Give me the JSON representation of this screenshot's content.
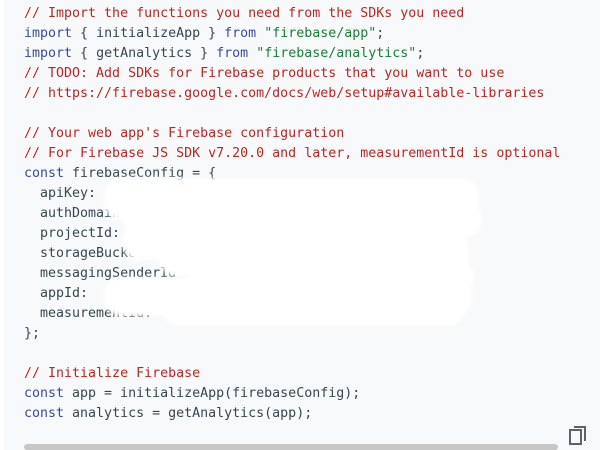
{
  "code_lines": [
    [
      {
        "t": "// Import the functions you need from the SDKs you need",
        "c": "comment"
      }
    ],
    [
      {
        "t": "import",
        "c": "keyword"
      },
      {
        "t": " { initializeApp } ",
        "c": "plain"
      },
      {
        "t": "from",
        "c": "keyword"
      },
      {
        "t": " ",
        "c": "plain"
      },
      {
        "t": "\"firebase/app\"",
        "c": "string"
      },
      {
        "t": ";",
        "c": "plain"
      }
    ],
    [
      {
        "t": "import",
        "c": "keyword"
      },
      {
        "t": " { getAnalytics } ",
        "c": "plain"
      },
      {
        "t": "from",
        "c": "keyword"
      },
      {
        "t": " ",
        "c": "plain"
      },
      {
        "t": "\"firebase/analytics\"",
        "c": "string"
      },
      {
        "t": ";",
        "c": "plain"
      }
    ],
    [
      {
        "t": "// TODO: Add SDKs for Firebase products that you want to use",
        "c": "comment"
      }
    ],
    [
      {
        "t": "// https://firebase.google.com/docs/web/setup#available-libraries",
        "c": "comment"
      }
    ],
    [],
    [
      {
        "t": "// Your web app's Firebase configuration",
        "c": "comment"
      }
    ],
    [
      {
        "t": "// For Firebase JS SDK v7.20.0 and later, measurementId is optional",
        "c": "comment"
      }
    ],
    [
      {
        "t": "const",
        "c": "keyword"
      },
      {
        "t": " firebaseConfig = {",
        "c": "plain"
      }
    ],
    [
      {
        "t": "  apiKey:",
        "c": "plain"
      }
    ],
    [
      {
        "t": "  authDomain",
        "c": "plain"
      }
    ],
    [
      {
        "t": "  projectId:",
        "c": "plain"
      }
    ],
    [
      {
        "t": "  storageBucket:",
        "c": "plain"
      }
    ],
    [
      {
        "t": "  messagingSenderId",
        "c": "plain"
      }
    ],
    [
      {
        "t": "  appId:",
        "c": "plain"
      }
    ],
    [
      {
        "t": "  measurementId:",
        "c": "plain"
      }
    ],
    [
      {
        "t": "};",
        "c": "plain"
      }
    ],
    [],
    [
      {
        "t": "// Initialize Firebase",
        "c": "comment"
      }
    ],
    [
      {
        "t": "const",
        "c": "keyword"
      },
      {
        "t": " app = initializeApp(firebaseConfig);",
        "c": "plain"
      }
    ],
    [
      {
        "t": "const",
        "c": "keyword"
      },
      {
        "t": " analytics = getAnalytics(app);",
        "c": "plain"
      }
    ]
  ],
  "colors": {
    "comment": "#c5221f",
    "keyword": "#3949ab",
    "string": "#188038",
    "plain": "#37474f",
    "background": "#f8f9fa"
  },
  "icons": {
    "copy": "copy-icon"
  }
}
